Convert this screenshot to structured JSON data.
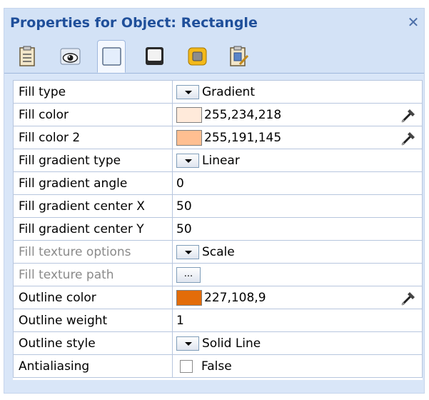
{
  "panel": {
    "title": "Properties for Object: Rectangle",
    "close_glyph": "✕",
    "tabs": [
      {
        "name": "clipboard-tab",
        "icon": "clipboard-icon"
      },
      {
        "name": "view-tab",
        "icon": "eye-icon"
      },
      {
        "name": "fill-tab",
        "icon": "rectangle-fill-icon",
        "active": true
      },
      {
        "name": "shadow-tab",
        "icon": "shadow-rectangle-icon"
      },
      {
        "name": "frame-tab",
        "icon": "frame-icon"
      },
      {
        "name": "properties-tab",
        "icon": "clipboard-edit-icon"
      }
    ]
  },
  "properties": [
    {
      "label": "Fill type",
      "type": "dropdown",
      "value": "Gradient"
    },
    {
      "label": "Fill color",
      "type": "color",
      "value": "255,234,218",
      "color": "#ffeada"
    },
    {
      "label": "Fill color 2",
      "type": "color",
      "value": "255,191,145",
      "color": "#ffbf91"
    },
    {
      "label": "Fill gradient type",
      "type": "dropdown",
      "value": "Linear"
    },
    {
      "label": "Fill gradient angle",
      "type": "text",
      "value": "0"
    },
    {
      "label": "Fill gradient center X",
      "type": "text",
      "value": "50"
    },
    {
      "label": "Fill gradient center Y",
      "type": "text",
      "value": "50"
    },
    {
      "label": "Fill texture options",
      "type": "dropdown",
      "value": "Scale",
      "disabled": true
    },
    {
      "label": "Fill texture path",
      "type": "ellipsis",
      "value": "...",
      "disabled": true
    },
    {
      "label": "Outline color",
      "type": "color",
      "value": "227,108,9",
      "color": "#e36c09"
    },
    {
      "label": "Outline weight",
      "type": "text",
      "value": "1"
    },
    {
      "label": "Outline style",
      "type": "dropdown",
      "value": "Solid Line"
    },
    {
      "label": "Antialiasing",
      "type": "checkbox",
      "value": "False"
    }
  ]
}
